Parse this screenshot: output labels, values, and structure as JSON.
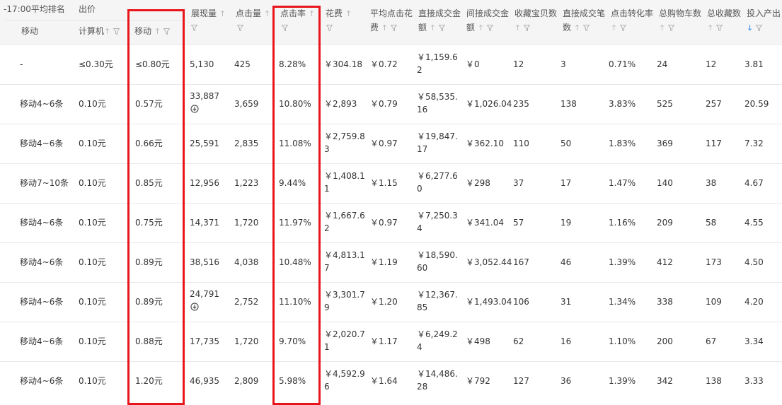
{
  "header": {
    "rank_col_top": "-17:00平均排名",
    "rank_col_sub": "移动",
    "bid_col_top": "出价",
    "bid_pc": "计算机",
    "bid_mobile": "移动",
    "impressions": "展现量",
    "clicks": "点击量",
    "ctr": "点击率",
    "cost": "花费",
    "avg_cpc_1": "平均点击花",
    "avg_cpc_2": "费",
    "direct_gmv_1": "直接成交金",
    "direct_gmv_2": "额",
    "indirect_gmv_1": "间接成交金",
    "indirect_gmv_2": "额",
    "fav_items": "收藏宝贝数",
    "direct_orders_1": "直接成交笔",
    "direct_orders_2": "数",
    "conv_rate": "点击转化率",
    "cart": "总购物车数",
    "fav_total": "总收藏数",
    "roi": "投入产出"
  },
  "icons": {
    "sort": "sort-up-arrow-icon",
    "filter": "filter-funnel-icon",
    "sort_active": "sort-down-arrow-active-icon",
    "download": "download-circle-icon"
  },
  "colors": {
    "highlight_box": "#e8161b",
    "sort_active": "#2f80ed"
  },
  "rows": [
    {
      "rank": "-",
      "pc_bid": "≤0.30元",
      "mobile_bid": "≤0.80元",
      "impressions": "5,130",
      "clicks": "425",
      "ctr": "8.28%",
      "cost": "￥304.18",
      "cpc": "￥0.72",
      "direct_gmv": "￥1,159.62",
      "indirect_gmv": "￥0",
      "fav_items": "12",
      "direct_orders": "3",
      "conv_rate": "0.71%",
      "cart": "24",
      "fav_total": "12",
      "roi": "3.81"
    },
    {
      "rank": "移动4~6条",
      "pc_bid": "0.10元",
      "mobile_bid": "0.57元",
      "impressions": "33,887",
      "clicks": "3,659",
      "ctr": "10.80%",
      "cost": "￥2,893",
      "cpc": "￥0.79",
      "direct_gmv": "￥58,535.16",
      "indirect_gmv": "￥1,026.04",
      "fav_items": "235",
      "direct_orders": "138",
      "conv_rate": "3.83%",
      "cart": "525",
      "fav_total": "257",
      "roi": "20.59"
    },
    {
      "rank": "移动4~6条",
      "pc_bid": "0.10元",
      "mobile_bid": "0.66元",
      "impressions": "25,591",
      "clicks": "2,835",
      "ctr": "11.08%",
      "cost": "￥2,759.83",
      "cpc": "￥0.97",
      "direct_gmv": "￥19,847.17",
      "indirect_gmv": "￥362.10",
      "fav_items": "110",
      "direct_orders": "50",
      "conv_rate": "1.83%",
      "cart": "369",
      "fav_total": "117",
      "roi": "7.32"
    },
    {
      "rank": "移动7~10条",
      "pc_bid": "0.10元",
      "mobile_bid": "0.85元",
      "impressions": "12,956",
      "clicks": "1,223",
      "ctr": "9.44%",
      "cost": "￥1,408.11",
      "cpc": "￥1.15",
      "direct_gmv": "￥6,277.60",
      "indirect_gmv": "￥298",
      "fav_items": "37",
      "direct_orders": "17",
      "conv_rate": "1.47%",
      "cart": "140",
      "fav_total": "38",
      "roi": "4.67"
    },
    {
      "rank": "移动4~6条",
      "pc_bid": "0.10元",
      "mobile_bid": "0.75元",
      "impressions": "14,371",
      "clicks": "1,720",
      "ctr": "11.97%",
      "cost": "￥1,667.62",
      "cpc": "￥0.97",
      "direct_gmv": "￥7,250.34",
      "indirect_gmv": "￥341.04",
      "fav_items": "57",
      "direct_orders": "19",
      "conv_rate": "1.16%",
      "cart": "209",
      "fav_total": "58",
      "roi": "4.55"
    },
    {
      "rank": "移动4~6条",
      "pc_bid": "0.10元",
      "mobile_bid": "0.89元",
      "impressions": "38,516",
      "clicks": "4,038",
      "ctr": "10.48%",
      "cost": "￥4,813.17",
      "cpc": "￥1.19",
      "direct_gmv": "￥18,590.60",
      "indirect_gmv": "￥3,052.44",
      "fav_items": "167",
      "direct_orders": "46",
      "conv_rate": "1.39%",
      "cart": "412",
      "fav_total": "173",
      "roi": "4.50"
    },
    {
      "rank": "移动4~6条",
      "pc_bid": "0.10元",
      "mobile_bid": "0.89元",
      "impressions": "24,791",
      "clicks": "2,752",
      "ctr": "11.10%",
      "cost": "￥3,301.79",
      "cpc": "￥1.20",
      "direct_gmv": "￥12,367.85",
      "indirect_gmv": "￥1,493.04",
      "fav_items": "106",
      "direct_orders": "31",
      "conv_rate": "1.34%",
      "cart": "338",
      "fav_total": "109",
      "roi": "4.20"
    },
    {
      "rank": "移动4~6条",
      "pc_bid": "0.10元",
      "mobile_bid": "0.88元",
      "impressions": "17,735",
      "clicks": "1,720",
      "ctr": "9.70%",
      "cost": "￥2,020.71",
      "cpc": "￥1.17",
      "direct_gmv": "￥6,249.24",
      "indirect_gmv": "￥498",
      "fav_items": "62",
      "direct_orders": "16",
      "conv_rate": "1.10%",
      "cart": "200",
      "fav_total": "67",
      "roi": "3.34"
    },
    {
      "rank": "移动4~6条",
      "pc_bid": "0.10元",
      "mobile_bid": "1.20元",
      "impressions": "46,935",
      "clicks": "2,809",
      "ctr": "5.98%",
      "cost": "￥4,592.96",
      "cpc": "￥1.64",
      "direct_gmv": "￥14,486.28",
      "indirect_gmv": "￥792",
      "fav_items": "127",
      "direct_orders": "36",
      "conv_rate": "1.39%",
      "cart": "342",
      "fav_total": "138",
      "roi": "3.33"
    }
  ]
}
